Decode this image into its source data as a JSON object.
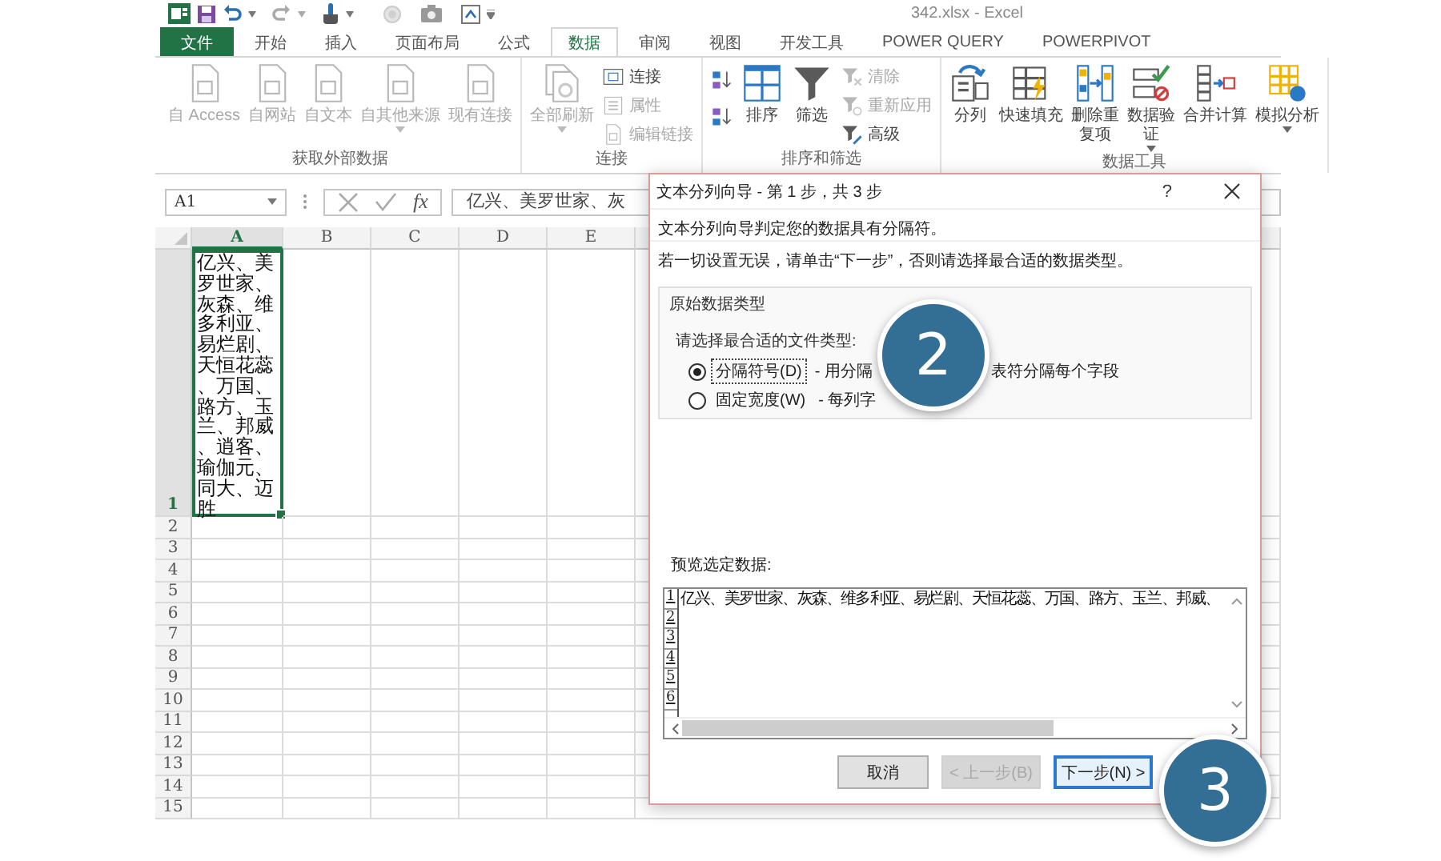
{
  "window": {
    "title": "342.xlsx - Excel"
  },
  "tabs": [
    {
      "label": "文件",
      "kind": "file",
      "selected": false
    },
    {
      "label": "开始",
      "kind": "tab",
      "selected": false
    },
    {
      "label": "插入",
      "kind": "tab",
      "selected": false
    },
    {
      "label": "页面布局",
      "kind": "tab",
      "selected": false
    },
    {
      "label": "公式",
      "kind": "tab",
      "selected": false
    },
    {
      "label": "数据",
      "kind": "tab",
      "selected": true
    },
    {
      "label": "审阅",
      "kind": "tab",
      "selected": false
    },
    {
      "label": "视图",
      "kind": "tab",
      "selected": false
    },
    {
      "label": "开发工具",
      "kind": "tab",
      "selected": false
    },
    {
      "label": "POWER QUERY",
      "kind": "tab",
      "selected": false
    },
    {
      "label": "POWERPIVOT",
      "kind": "tab",
      "selected": false
    }
  ],
  "ribbon_groups": [
    {
      "title": "获取外部数据",
      "items": [
        {
          "label": "自 Access",
          "kind": "large",
          "disabled": true,
          "dropdown": false
        },
        {
          "label": "自网站",
          "kind": "large",
          "disabled": true,
          "dropdown": false
        },
        {
          "label": "自文本",
          "kind": "large",
          "disabled": true,
          "dropdown": false
        },
        {
          "label": "自其他来源",
          "kind": "large",
          "disabled": true,
          "dropdown": true
        },
        {
          "label": "现有连接",
          "kind": "large",
          "disabled": true,
          "dropdown": false
        }
      ]
    },
    {
      "title": "连接",
      "items": [
        {
          "label": "全部刷新",
          "kind": "large",
          "disabled": true,
          "dropdown": true
        },
        {
          "label": "连接",
          "kind": "small",
          "disabled": false,
          "dropdown": false
        },
        {
          "label": "属性",
          "kind": "small",
          "disabled": true,
          "dropdown": false
        },
        {
          "label": "编辑链接",
          "kind": "small",
          "disabled": true,
          "dropdown": false
        }
      ]
    },
    {
      "title": "排序和筛选",
      "items": [
        {
          "kind": "icon",
          "disabled": false,
          "dropdown": false
        },
        {
          "kind": "icon",
          "disabled": false,
          "dropdown": false
        },
        {
          "label": "排序",
          "kind": "large",
          "disabled": false,
          "dropdown": false
        },
        {
          "label": "筛选",
          "kind": "large",
          "disabled": false,
          "dropdown": false
        },
        {
          "label": "清除",
          "kind": "small",
          "disabled": true,
          "dropdown": false
        },
        {
          "label": "重新应用",
          "kind": "small",
          "disabled": true,
          "dropdown": false
        },
        {
          "label": "高级",
          "kind": "small",
          "disabled": false,
          "dropdown": false
        }
      ]
    },
    {
      "title": "数据工具",
      "items": [
        {
          "label": "分列",
          "kind": "large",
          "disabled": false,
          "dropdown": false
        },
        {
          "label": "快速填充",
          "kind": "large",
          "disabled": false,
          "dropdown": false
        },
        {
          "label": "删除重复项",
          "wrapped": true,
          "kind": "large",
          "disabled": false,
          "dropdown": false
        },
        {
          "label": "数据验证",
          "wrapped": true,
          "kind": "large",
          "disabled": false,
          "dropdown": true
        },
        {
          "label": "合并计算",
          "kind": "large",
          "disabled": false,
          "dropdown": false
        },
        {
          "label": "模拟分析",
          "kind": "large",
          "disabled": false,
          "dropdown": true
        }
      ]
    }
  ],
  "formula_bar": {
    "name_box": "A1",
    "function_label": "fx",
    "value": "亿兴、美罗世家、灰"
  },
  "sheet": {
    "columns": [
      {
        "label": "A",
        "selected": true
      },
      {
        "label": "B",
        "selected": false
      },
      {
        "label": "C",
        "selected": false
      },
      {
        "label": "D",
        "selected": false
      },
      {
        "label": "E",
        "selected": false
      }
    ],
    "rows": [
      {
        "label": "1",
        "selected": true,
        "cells": [
          "亿兴、美罗世家、灰森、维多利亚、易烂剧、天恒花蕊、万国、路方、玉兰、邦威、逍客、瑜伽元、同大、迈胜"
        ]
      },
      {
        "label": "2",
        "selected": false
      },
      {
        "label": "3",
        "selected": false
      },
      {
        "label": "4",
        "selected": false
      },
      {
        "label": "5",
        "selected": false
      },
      {
        "label": "6",
        "selected": false
      },
      {
        "label": "7",
        "selected": false
      },
      {
        "label": "8",
        "selected": false
      },
      {
        "label": "9",
        "selected": false
      },
      {
        "label": "10",
        "selected": false
      },
      {
        "label": "11",
        "selected": false
      },
      {
        "label": "12",
        "selected": false
      },
      {
        "label": "13",
        "selected": false
      },
      {
        "label": "14",
        "selected": false
      },
      {
        "label": "15",
        "selected": false
      }
    ]
  },
  "dialog": {
    "title": "文本分列向导 - 第 1 步，共 3 步",
    "help": "?",
    "messages": [
      "文本分列向导判定您的数据具有分隔符。",
      "若一切设置无误，请单击“下一步”，否则请选择最合适的数据类型。"
    ],
    "group_title": "原始数据类型",
    "prompt": "请选择最合适的文件类型:",
    "options": [
      {
        "label": "分隔符号(D)",
        "description_parts": [
          "- 用分隔",
          "表符分隔每个字段"
        ],
        "selected": true
      },
      {
        "label": "固定宽度(W)",
        "description_parts": [
          "- 每列字"
        ],
        "selected": false
      }
    ],
    "preview_label": "预览选定数据:",
    "preview_row_numbers": [
      "1",
      "2",
      "3",
      "4",
      "5",
      "6"
    ],
    "preview_lines": [
      "亿兴、美罗世家、灰森、维多利亚、易烂剧、天恒花蕊、万国、路方、玉兰、邦威、"
    ],
    "buttons": [
      {
        "label": "取消",
        "disabled": false,
        "default": false
      },
      {
        "label": "< 上一步(B)",
        "disabled": true,
        "default": false
      },
      {
        "label": "下一步(N) >",
        "disabled": false,
        "default": true
      }
    ]
  },
  "step_badges": [
    {
      "label": "2"
    },
    {
      "label": "3"
    }
  ]
}
